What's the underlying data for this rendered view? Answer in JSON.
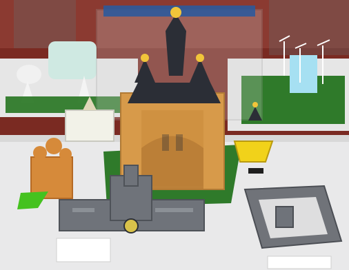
{
  "photo": {
    "subject": "",
    "palette": {
      "floor": "#7a2a22",
      "table": "#e9e9ea",
      "grass": "#2f7a2a",
      "wood": "#d79a4a",
      "roof": "#2b2e36",
      "gold": "#f1c53a",
      "gray_model": "#6f737a"
    }
  },
  "captions": {
    "left_card": "",
    "right_card": ""
  }
}
